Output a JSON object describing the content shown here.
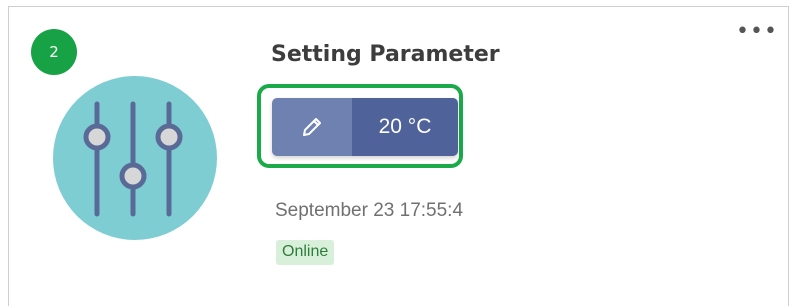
{
  "step_badge": "2",
  "card": {
    "title": "Setting Parameter",
    "more_icon": "more-horizontal-icon",
    "avatar_icon": "sliders-icon",
    "parameter": {
      "edit_icon": "pencil-icon",
      "value": "20 °C"
    },
    "timestamp": "September 23 17:55:4",
    "status": "Online"
  },
  "colors": {
    "step_badge": "#18a246",
    "highlight": "#1aaa4a",
    "avatar_bg": "#7dcdd3",
    "slider_lines": "#596a96",
    "edit_button": "#6e81b1",
    "value_field": "#4f629a",
    "status_bg": "#d8f0da",
    "status_text": "#2e7d3a"
  }
}
